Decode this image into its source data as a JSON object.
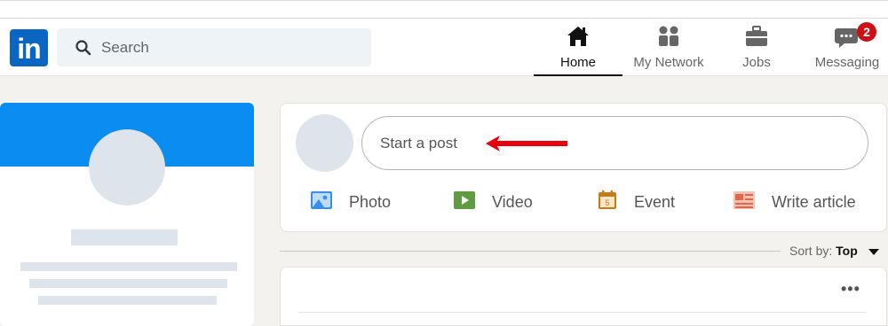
{
  "header": {
    "logo_text": "in",
    "search": {
      "placeholder": "Search",
      "value": ""
    },
    "nav": [
      {
        "label": "Home",
        "icon": "home-icon",
        "active": true
      },
      {
        "label": "My Network",
        "icon": "network-icon",
        "active": false
      },
      {
        "label": "Jobs",
        "icon": "briefcase-icon",
        "active": false
      },
      {
        "label": "Messaging",
        "icon": "messaging-icon",
        "active": false,
        "badge": "2"
      }
    ]
  },
  "composer": {
    "placeholder": "Start a post",
    "actions": [
      {
        "label": "Photo",
        "icon": "photo-icon",
        "color": "#378fe9"
      },
      {
        "label": "Video",
        "icon": "video-icon",
        "color": "#5f9b41"
      },
      {
        "label": "Event",
        "icon": "event-icon",
        "color": "#c37d16"
      },
      {
        "label": "Write article",
        "icon": "article-icon",
        "color": "#e06847"
      }
    ]
  },
  "feed": {
    "sort_prefix": "Sort by:",
    "sort_value": "Top",
    "more_label": "•••"
  },
  "colors": {
    "brand": "#0a66c2",
    "banner": "#0a8cf0",
    "badge": "#cc1016",
    "annotation_arrow": "#e8000b"
  }
}
